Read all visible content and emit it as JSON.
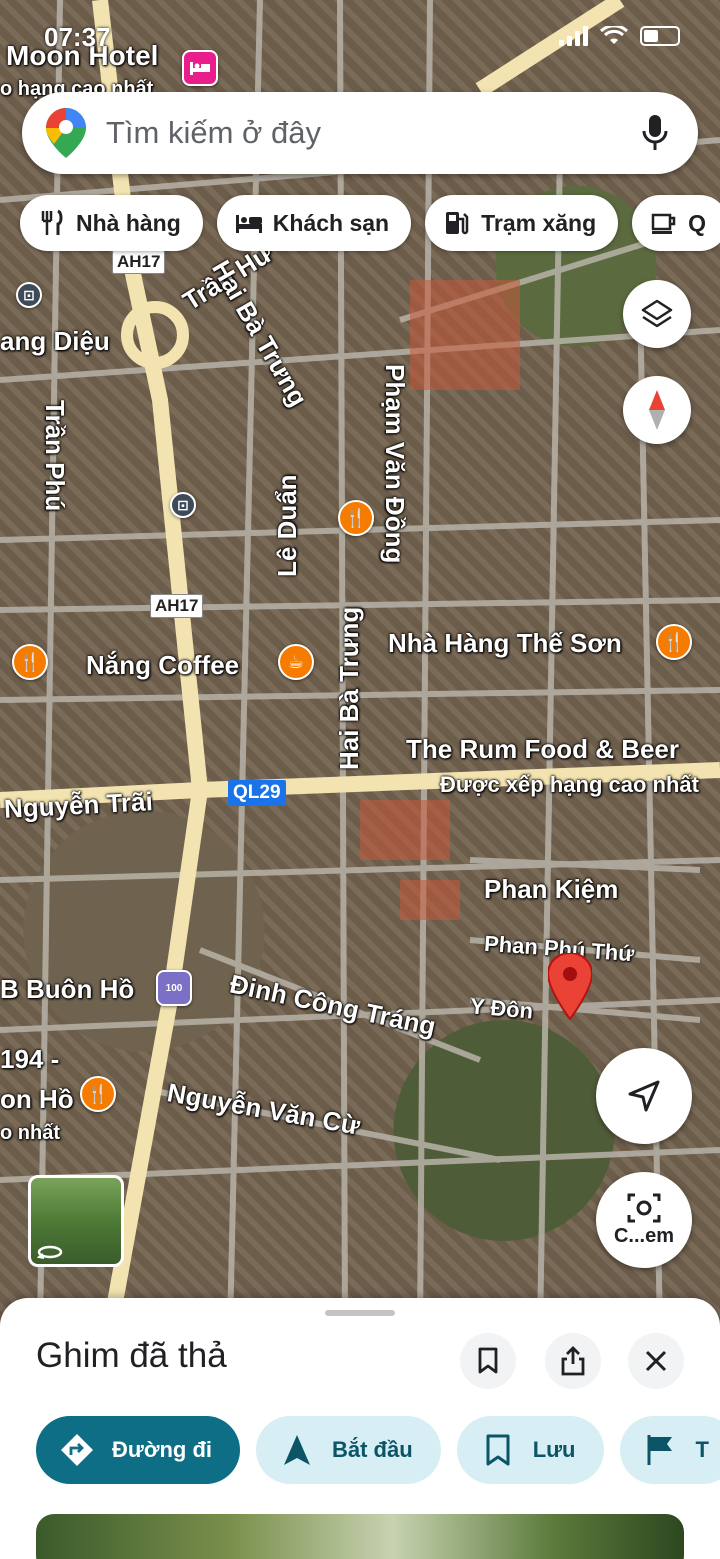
{
  "status_bar": {
    "time": "07:37"
  },
  "search": {
    "placeholder": "Tìm kiếm ở đây"
  },
  "chips": [
    {
      "icon": "restaurant-icon",
      "label": "Nhà hàng"
    },
    {
      "icon": "hotel-icon",
      "label": "Khách sạn"
    },
    {
      "icon": "gas-station-icon",
      "label": "Trạm xăng"
    },
    {
      "icon": "coffee-icon",
      "label": "Q"
    }
  ],
  "map": {
    "labels": {
      "moon_hotel": "Moon Hotel",
      "moon_hotel_sub": "o hạng cao nhất",
      "tran_hung": "Trần Hư",
      "hai_ba_trung_1": "Hai Bà Trưng",
      "pham_van_dong": "Phạm Văn Đồng",
      "hoang_dieu": "ang Diệu",
      "tran_phu": "Trần Phú",
      "le_duan": "Lê Duẩn",
      "hai_ba_trung_2": "Hai Bà Trưng",
      "nha_hang_the_son": "Nhà Hàng Thế Sơn",
      "nang_coffee": "Nắng Coffee",
      "rum_food": "The Rum Food & Beer",
      "rum_food_sub": "Được xếp hạng cao nhất",
      "nguyen_trai": "Nguyễn Trãi",
      "phan_kiem": "Phan Kiệm",
      "phan_phu_thu": "Phan Phú Thứ",
      "y_don": "Y Đôn",
      "buon_ho": "B Buôn Hồ",
      "dinh_cong_trang": "Đinh Công Tráng",
      "left_194": "194 -",
      "left_on_ho": "on Hồ",
      "left_o_nhat": "o nhất",
      "nguyen_van_cu": "Nguyễn Văn Cừ"
    },
    "shields": {
      "ah17_a": "AH17",
      "ah17_b": "AH17",
      "ql29": "QL29",
      "poi_100": "100"
    }
  },
  "camera_button_label": "C...em",
  "sheet": {
    "title": "Ghim đã thả",
    "actions": [
      {
        "icon": "directions-icon",
        "label": "Đường đi"
      },
      {
        "icon": "navigation-start-icon",
        "label": "Bắt đầu"
      },
      {
        "icon": "bookmark-icon",
        "label": "Lưu"
      },
      {
        "icon": "flag-icon",
        "label": "T"
      }
    ]
  },
  "colors": {
    "primary": "#0d6e86",
    "secondary_bg": "#d7eef5",
    "pin_red": "#ea4335",
    "poi_orange": "#f57c00"
  }
}
